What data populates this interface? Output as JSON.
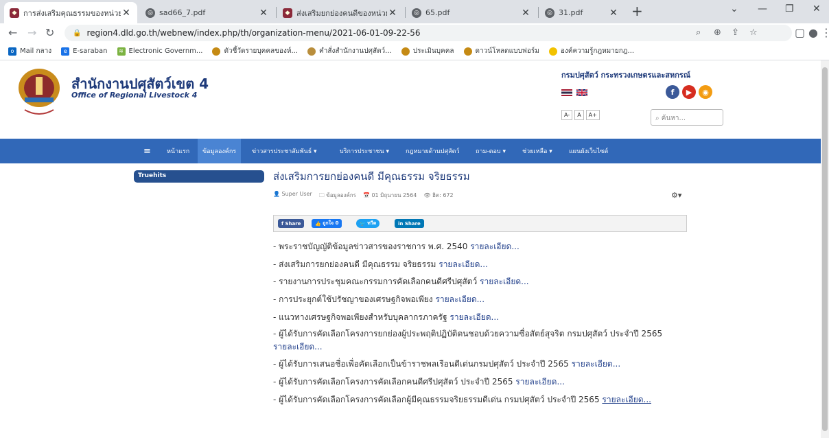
{
  "browser": {
    "tabs": [
      {
        "title": "การส่งเสริมคุณธรรมของหน่วยงาน",
        "favicon": "dld"
      },
      {
        "title": "sad66_7.pdf",
        "favicon": "globe"
      },
      {
        "title": "ส่งเสริมยกย่องคนดีของหน่วยงาน",
        "favicon": "dld"
      },
      {
        "title": "65.pdf",
        "favicon": "globe"
      },
      {
        "title": "31.pdf",
        "favicon": "globe"
      }
    ],
    "url": "region4.dld.go.th/webnew/index.php/th/organization-menu/2021-06-01-09-22-56",
    "bookmarks": [
      "Mail กลาง",
      "E-saraban",
      "Electronic Governm...",
      "ตัวชี้วัดรายบุคคลของห์...",
      "คำสั่งสำนักงานปศุสัตว์...",
      "ประเมินบุคคล",
      "ดาวน์โหลดแบบฟอร์ม",
      "องค์ความรู้กฎหมายกฎ..."
    ]
  },
  "site": {
    "title": "สำนักงานปศุสัตว์เขต 4",
    "subtitle": "Office of Regional Livestock 4",
    "dept": "กรมปศุสัตว์ กระทรวงเกษตรและสหกรณ์",
    "font_buttons": [
      "A-",
      "A",
      "A+"
    ],
    "search_placeholder": "ค้นหา..."
  },
  "menu": [
    "หน้าแรก",
    "ข้อมูลองค์กร",
    "ข่าวสารประชาสัมพันธ์ ▾",
    "บริการประชาชน ▾",
    "กฎหมายด้านปศุสัตว์",
    "ถาม-ตอบ ▾",
    "ช่วยเหลือ ▾",
    "แผนผังเว็บไซต์"
  ],
  "sidebar": {
    "truehits": "Truehits"
  },
  "article": {
    "title": "ส่งเสริมการยกย่องคนดี มีคุณธรรม จริยธรรม",
    "author": "Super User",
    "category": "ข้อมูลองค์กร",
    "date": "01 มิถุนายน 2564",
    "hits": "ฮิต: 672",
    "share": {
      "fb": "Share",
      "like": "ถูกใจ 0",
      "tw": "ทวีต",
      "li": "Share"
    },
    "items": [
      {
        "text": "- พระราชบัญญัติข้อมูลข่าวสารของราชการ พ.ศ. 2540 ",
        "link": "รายละเอียด..."
      },
      {
        "text": "- ส่งเสริมการยกย่องคนดี มีคุณธรรม จริยธรรม ",
        "link": "รายละเอียด..."
      },
      {
        "text": "- รายงานการประชุมคณะกรรมการคัดเลือกคนดีศรีปศุสัตว์ ",
        "link": "รายละเอียด..."
      },
      {
        "text": "- การประยุกต์ใช้ปรัชญาของเศรษฐกิจพอเพียง ",
        "link": "รายละเอียด..."
      },
      {
        "text": "- แนวทางเศรษฐกิจพอเพียงสำหรับบุคลากรภาครัฐ ",
        "link": "รายละเอียด..."
      },
      {
        "text": "- ผู้ได้รับการคัดเลือกโครงการยกย่องผู้ประพฤติปฏิบัติตนชอบด้วยความซื่อสัตย์สุจริต กรมปศุสัตว์ ประจำปี 2565",
        "link": "รายละเอียด..."
      },
      {
        "text": "- ผู้ได้รับการเสนอชื่อเพื่อคัดเลือกเป็นข้าราชพลเรือนดีเด่นกรมปศุสัตว์ ประจำปี 2565 ",
        "link": "รายละเอียด..."
      },
      {
        "text": "- ผู้ได้รับการคัดเลือกโครงการคัดเลือกคนดีศรีปศุสัตว์ ประจำปี 2565 ",
        "link": "รายละเอียด..."
      },
      {
        "text": "- ผู้ได้รับการคัดเลือกโครงการคัดเลือกผู้มีคุณธรรมจริยธรรมดีเด่น กรมปศุสัตว์ ประจำปี 2565 ",
        "link": "รายละเอียด..."
      }
    ]
  }
}
